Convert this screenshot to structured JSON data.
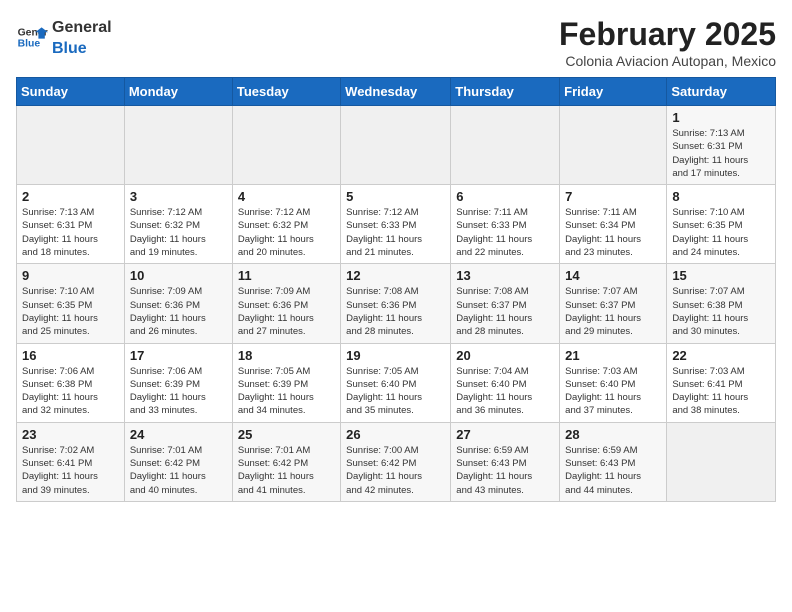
{
  "header": {
    "logo_general": "General",
    "logo_blue": "Blue",
    "month_year": "February 2025",
    "location": "Colonia Aviacion Autopan, Mexico"
  },
  "weekdays": [
    "Sunday",
    "Monday",
    "Tuesday",
    "Wednesday",
    "Thursday",
    "Friday",
    "Saturday"
  ],
  "weeks": [
    [
      {
        "day": "",
        "info": ""
      },
      {
        "day": "",
        "info": ""
      },
      {
        "day": "",
        "info": ""
      },
      {
        "day": "",
        "info": ""
      },
      {
        "day": "",
        "info": ""
      },
      {
        "day": "",
        "info": ""
      },
      {
        "day": "1",
        "info": "Sunrise: 7:13 AM\nSunset: 6:31 PM\nDaylight: 11 hours\nand 17 minutes."
      }
    ],
    [
      {
        "day": "2",
        "info": "Sunrise: 7:13 AM\nSunset: 6:31 PM\nDaylight: 11 hours\nand 18 minutes."
      },
      {
        "day": "3",
        "info": "Sunrise: 7:12 AM\nSunset: 6:32 PM\nDaylight: 11 hours\nand 19 minutes."
      },
      {
        "day": "4",
        "info": "Sunrise: 7:12 AM\nSunset: 6:32 PM\nDaylight: 11 hours\nand 20 minutes."
      },
      {
        "day": "5",
        "info": "Sunrise: 7:12 AM\nSunset: 6:33 PM\nDaylight: 11 hours\nand 21 minutes."
      },
      {
        "day": "6",
        "info": "Sunrise: 7:11 AM\nSunset: 6:33 PM\nDaylight: 11 hours\nand 22 minutes."
      },
      {
        "day": "7",
        "info": "Sunrise: 7:11 AM\nSunset: 6:34 PM\nDaylight: 11 hours\nand 23 minutes."
      },
      {
        "day": "8",
        "info": "Sunrise: 7:10 AM\nSunset: 6:35 PM\nDaylight: 11 hours\nand 24 minutes."
      }
    ],
    [
      {
        "day": "9",
        "info": "Sunrise: 7:10 AM\nSunset: 6:35 PM\nDaylight: 11 hours\nand 25 minutes."
      },
      {
        "day": "10",
        "info": "Sunrise: 7:09 AM\nSunset: 6:36 PM\nDaylight: 11 hours\nand 26 minutes."
      },
      {
        "day": "11",
        "info": "Sunrise: 7:09 AM\nSunset: 6:36 PM\nDaylight: 11 hours\nand 27 minutes."
      },
      {
        "day": "12",
        "info": "Sunrise: 7:08 AM\nSunset: 6:36 PM\nDaylight: 11 hours\nand 28 minutes."
      },
      {
        "day": "13",
        "info": "Sunrise: 7:08 AM\nSunset: 6:37 PM\nDaylight: 11 hours\nand 28 minutes."
      },
      {
        "day": "14",
        "info": "Sunrise: 7:07 AM\nSunset: 6:37 PM\nDaylight: 11 hours\nand 29 minutes."
      },
      {
        "day": "15",
        "info": "Sunrise: 7:07 AM\nSunset: 6:38 PM\nDaylight: 11 hours\nand 30 minutes."
      }
    ],
    [
      {
        "day": "16",
        "info": "Sunrise: 7:06 AM\nSunset: 6:38 PM\nDaylight: 11 hours\nand 32 minutes."
      },
      {
        "day": "17",
        "info": "Sunrise: 7:06 AM\nSunset: 6:39 PM\nDaylight: 11 hours\nand 33 minutes."
      },
      {
        "day": "18",
        "info": "Sunrise: 7:05 AM\nSunset: 6:39 PM\nDaylight: 11 hours\nand 34 minutes."
      },
      {
        "day": "19",
        "info": "Sunrise: 7:05 AM\nSunset: 6:40 PM\nDaylight: 11 hours\nand 35 minutes."
      },
      {
        "day": "20",
        "info": "Sunrise: 7:04 AM\nSunset: 6:40 PM\nDaylight: 11 hours\nand 36 minutes."
      },
      {
        "day": "21",
        "info": "Sunrise: 7:03 AM\nSunset: 6:40 PM\nDaylight: 11 hours\nand 37 minutes."
      },
      {
        "day": "22",
        "info": "Sunrise: 7:03 AM\nSunset: 6:41 PM\nDaylight: 11 hours\nand 38 minutes."
      }
    ],
    [
      {
        "day": "23",
        "info": "Sunrise: 7:02 AM\nSunset: 6:41 PM\nDaylight: 11 hours\nand 39 minutes."
      },
      {
        "day": "24",
        "info": "Sunrise: 7:01 AM\nSunset: 6:42 PM\nDaylight: 11 hours\nand 40 minutes."
      },
      {
        "day": "25",
        "info": "Sunrise: 7:01 AM\nSunset: 6:42 PM\nDaylight: 11 hours\nand 41 minutes."
      },
      {
        "day": "26",
        "info": "Sunrise: 7:00 AM\nSunset: 6:42 PM\nDaylight: 11 hours\nand 42 minutes."
      },
      {
        "day": "27",
        "info": "Sunrise: 6:59 AM\nSunset: 6:43 PM\nDaylight: 11 hours\nand 43 minutes."
      },
      {
        "day": "28",
        "info": "Sunrise: 6:59 AM\nSunset: 6:43 PM\nDaylight: 11 hours\nand 44 minutes."
      },
      {
        "day": "",
        "info": ""
      }
    ]
  ]
}
